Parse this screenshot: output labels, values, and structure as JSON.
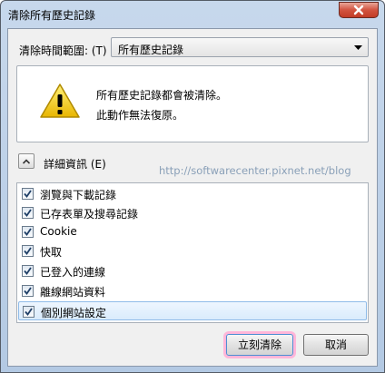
{
  "window": {
    "title": "清除所有歷史記錄"
  },
  "range": {
    "label": "清除時間範圍: (T)",
    "value": "所有歷史記錄"
  },
  "warning": {
    "line1": "所有歷史記錄都會被清除。",
    "line2": "此動作無法復原。"
  },
  "details": {
    "label": "詳細資訊 (E)"
  },
  "watermark": "http://softwarecenter.pixnet.net/blog",
  "items": [
    {
      "label": "瀏覽與下載記錄",
      "checked": true
    },
    {
      "label": "已存表單及搜尋記錄",
      "checked": true
    },
    {
      "label": "Cookie",
      "checked": true
    },
    {
      "label": "快取",
      "checked": true
    },
    {
      "label": "已登入的連線",
      "checked": true
    },
    {
      "label": "離線網站資料",
      "checked": true
    },
    {
      "label": "個別網站設定",
      "checked": true,
      "selected": true
    }
  ],
  "buttons": {
    "ok": "立刻清除",
    "cancel": "取消"
  },
  "icons": {
    "close": "close-icon",
    "warning": "warning-icon",
    "toggle": "chevron-up-icon",
    "dropdown": "chevron-down-icon"
  }
}
